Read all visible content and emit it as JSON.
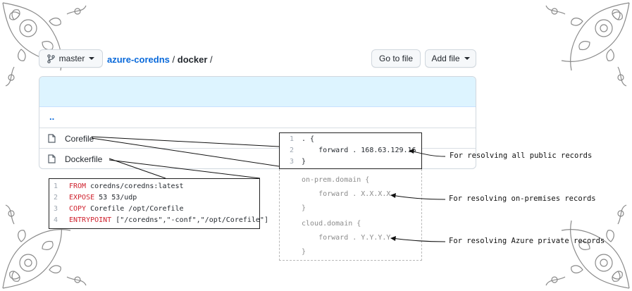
{
  "toolbar": {
    "branch_label": "master",
    "breadcrumb": {
      "repo": "azure-coredns",
      "sep1": "/",
      "folder": "docker",
      "sep2": "/"
    },
    "go_to_file": "Go to file",
    "add_file": "Add file"
  },
  "files": {
    "parent": "..",
    "items": [
      {
        "name": "Corefile"
      },
      {
        "name": "Dockerfile"
      }
    ]
  },
  "dockerfile_code": {
    "lines": [
      {
        "n": "1",
        "kw": "FROM",
        "rest": " coredns/coredns:latest"
      },
      {
        "n": "2",
        "kw": "EXPOSE",
        "rest": " 53 53/udp"
      },
      {
        "n": "3",
        "kw": "COPY",
        "rest": " Corefile /opt/Corefile"
      },
      {
        "n": "4",
        "kw": "ENTRYPOINT",
        "rest": " [\"/coredns\",\"-conf\",\"/opt/Corefile\"]"
      }
    ]
  },
  "corefile_code": {
    "lines": [
      {
        "n": "1",
        "text": ". {"
      },
      {
        "n": "2",
        "text": "    forward . 168.63.129.16"
      },
      {
        "n": "3",
        "text": "}"
      },
      {
        "n": "",
        "text": "on-prem.domain {"
      },
      {
        "n": "",
        "text": "    forward . X.X.X.X"
      },
      {
        "n": "",
        "text": "}"
      },
      {
        "n": "",
        "text": "cloud.domain {"
      },
      {
        "n": "",
        "text": "    forward . Y.Y.Y.Y"
      },
      {
        "n": "",
        "text": "}"
      }
    ]
  },
  "annotations": {
    "public": "For resolving all public records",
    "onprem": "For resolving on-premises records",
    "azure": "For resolving Azure private records"
  },
  "icons": {
    "branch": "git-branch-icon",
    "caret": "chevron-down-icon",
    "file": "file-icon"
  },
  "colors": {
    "link": "#0969da",
    "header_bg": "#ddf4ff",
    "keyword": "#cf222e"
  }
}
